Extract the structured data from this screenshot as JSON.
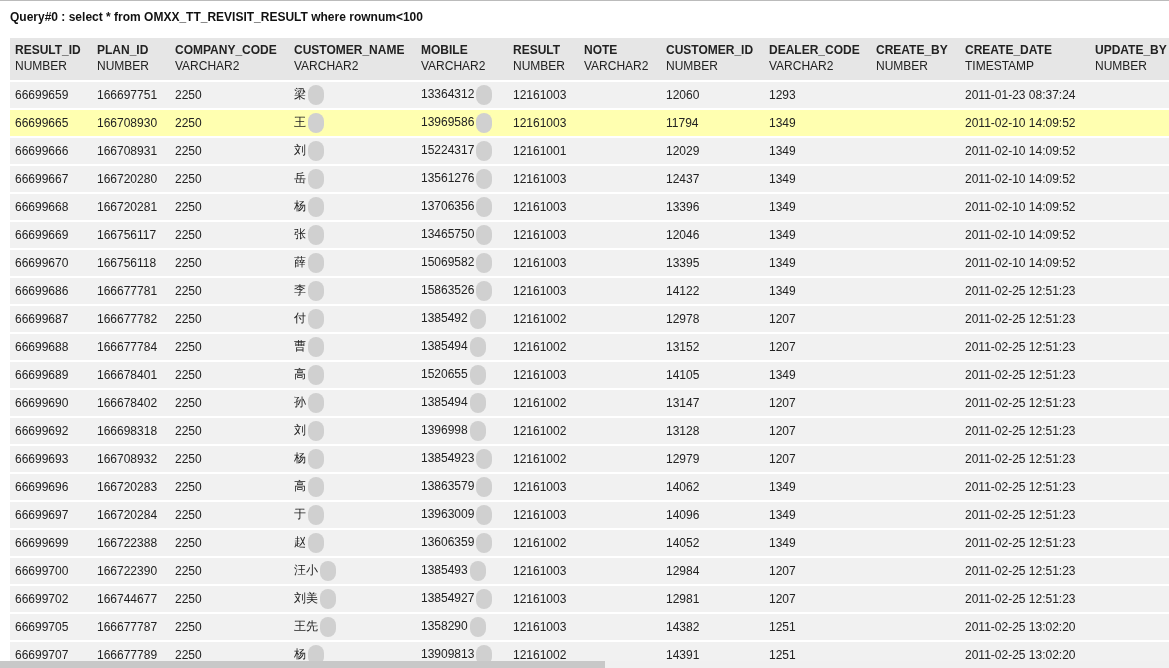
{
  "query_title": "Query#0 : select * from OMXX_TT_REVISIT_RESULT where rownum<100",
  "table": {
    "columns": [
      {
        "name": "RESULT_ID",
        "type": "NUMBER"
      },
      {
        "name": "PLAN_ID",
        "type": "NUMBER"
      },
      {
        "name": "COMPANY_CODE",
        "type": "VARCHAR2"
      },
      {
        "name": "CUSTOMER_NAME",
        "type": "VARCHAR2"
      },
      {
        "name": "MOBILE",
        "type": "VARCHAR2"
      },
      {
        "name": "RESULT",
        "type": "NUMBER"
      },
      {
        "name": "NOTE",
        "type": "VARCHAR2"
      },
      {
        "name": "CUSTOMER_ID",
        "type": "NUMBER"
      },
      {
        "name": "DEALER_CODE",
        "type": "VARCHAR2"
      },
      {
        "name": "CREATE_BY",
        "type": "NUMBER"
      },
      {
        "name": "CREATE_DATE",
        "type": "TIMESTAMP"
      },
      {
        "name": "UPDATE_BY",
        "type": "NUMBER"
      }
    ],
    "rows": [
      {
        "selected": false,
        "result_id": "66699659",
        "plan_id": "166697751",
        "company_code": "2250",
        "customer_name": "梁",
        "mobile": "13364312",
        "result": "12161003",
        "customer_id": "12060",
        "dealer_code": "1293",
        "create_date": "2011-01-23 08:37:24"
      },
      {
        "selected": true,
        "result_id": "66699665",
        "plan_id": "166708930",
        "company_code": "2250",
        "customer_name": "王",
        "mobile": "13969586",
        "result": "12161003",
        "customer_id": "11794",
        "dealer_code": "1349",
        "create_date": "2011-02-10 14:09:52"
      },
      {
        "selected": false,
        "result_id": "66699666",
        "plan_id": "166708931",
        "company_code": "2250",
        "customer_name": "刘",
        "mobile": "15224317",
        "result": "12161001",
        "customer_id": "12029",
        "dealer_code": "1349",
        "create_date": "2011-02-10 14:09:52"
      },
      {
        "selected": false,
        "result_id": "66699667",
        "plan_id": "166720280",
        "company_code": "2250",
        "customer_name": "岳",
        "mobile": "13561276",
        "result": "12161003",
        "customer_id": "12437",
        "dealer_code": "1349",
        "create_date": "2011-02-10 14:09:52"
      },
      {
        "selected": false,
        "result_id": "66699668",
        "plan_id": "166720281",
        "company_code": "2250",
        "customer_name": "杨",
        "mobile": "13706356",
        "result": "12161003",
        "customer_id": "13396",
        "dealer_code": "1349",
        "create_date": "2011-02-10 14:09:52"
      },
      {
        "selected": false,
        "result_id": "66699669",
        "plan_id": "166756117",
        "company_code": "2250",
        "customer_name": "张",
        "mobile": "13465750",
        "result": "12161003",
        "customer_id": "12046",
        "dealer_code": "1349",
        "create_date": "2011-02-10 14:09:52"
      },
      {
        "selected": false,
        "result_id": "66699670",
        "plan_id": "166756118",
        "company_code": "2250",
        "customer_name": "薛",
        "mobile": "15069582",
        "result": "12161003",
        "customer_id": "13395",
        "dealer_code": "1349",
        "create_date": "2011-02-10 14:09:52"
      },
      {
        "selected": false,
        "result_id": "66699686",
        "plan_id": "166677781",
        "company_code": "2250",
        "customer_name": "李",
        "mobile": "15863526",
        "result": "12161003",
        "customer_id": "14122",
        "dealer_code": "1349",
        "create_date": "2011-02-25 12:51:23"
      },
      {
        "selected": false,
        "result_id": "66699687",
        "plan_id": "166677782",
        "company_code": "2250",
        "customer_name": "付",
        "mobile": "1385492",
        "result": "12161002",
        "customer_id": "12978",
        "dealer_code": "1207",
        "create_date": "2011-02-25 12:51:23"
      },
      {
        "selected": false,
        "result_id": "66699688",
        "plan_id": "166677784",
        "company_code": "2250",
        "customer_name": "曹",
        "mobile": "1385494",
        "result": "12161002",
        "customer_id": "13152",
        "dealer_code": "1207",
        "create_date": "2011-02-25 12:51:23"
      },
      {
        "selected": false,
        "result_id": "66699689",
        "plan_id": "166678401",
        "company_code": "2250",
        "customer_name": "高",
        "mobile": "1520655",
        "result": "12161003",
        "customer_id": "14105",
        "dealer_code": "1349",
        "create_date": "2011-02-25 12:51:23"
      },
      {
        "selected": false,
        "result_id": "66699690",
        "plan_id": "166678402",
        "company_code": "2250",
        "customer_name": "孙",
        "mobile": "1385494",
        "result": "12161002",
        "customer_id": "13147",
        "dealer_code": "1207",
        "create_date": "2011-02-25 12:51:23"
      },
      {
        "selected": false,
        "result_id": "66699692",
        "plan_id": "166698318",
        "company_code": "2250",
        "customer_name": "刘",
        "mobile": "1396998",
        "result": "12161002",
        "customer_id": "13128",
        "dealer_code": "1207",
        "create_date": "2011-02-25 12:51:23"
      },
      {
        "selected": false,
        "result_id": "66699693",
        "plan_id": "166708932",
        "company_code": "2250",
        "customer_name": "杨",
        "mobile": "13854923",
        "result": "12161002",
        "customer_id": "12979",
        "dealer_code": "1207",
        "create_date": "2011-02-25 12:51:23"
      },
      {
        "selected": false,
        "result_id": "66699696",
        "plan_id": "166720283",
        "company_code": "2250",
        "customer_name": "高",
        "mobile": "13863579",
        "result": "12161003",
        "customer_id": "14062",
        "dealer_code": "1349",
        "create_date": "2011-02-25 12:51:23"
      },
      {
        "selected": false,
        "result_id": "66699697",
        "plan_id": "166720284",
        "company_code": "2250",
        "customer_name": "于",
        "mobile": "13963009",
        "result": "12161003",
        "customer_id": "14096",
        "dealer_code": "1349",
        "create_date": "2011-02-25 12:51:23"
      },
      {
        "selected": false,
        "result_id": "66699699",
        "plan_id": "166722388",
        "company_code": "2250",
        "customer_name": "赵",
        "mobile": "13606359",
        "result": "12161002",
        "customer_id": "14052",
        "dealer_code": "1349",
        "create_date": "2011-02-25 12:51:23"
      },
      {
        "selected": false,
        "result_id": "66699700",
        "plan_id": "166722390",
        "company_code": "2250",
        "customer_name": "汪小",
        "mobile": "1385493",
        "result": "12161003",
        "customer_id": "12984",
        "dealer_code": "1207",
        "create_date": "2011-02-25 12:51:23"
      },
      {
        "selected": false,
        "result_id": "66699702",
        "plan_id": "166744677",
        "company_code": "2250",
        "customer_name": "刘美",
        "mobile": "13854927",
        "result": "12161003",
        "customer_id": "12981",
        "dealer_code": "1207",
        "create_date": "2011-02-25 12:51:23"
      },
      {
        "selected": false,
        "result_id": "66699705",
        "plan_id": "166677787",
        "company_code": "2250",
        "customer_name": "王先",
        "mobile": "1358290",
        "result": "12161003",
        "customer_id": "14382",
        "dealer_code": "1251",
        "create_date": "2011-02-25 13:02:20"
      },
      {
        "selected": false,
        "result_id": "66699707",
        "plan_id": "166677789",
        "company_code": "2250",
        "customer_name": "杨",
        "mobile": "13909813",
        "result": "12161002",
        "customer_id": "14391",
        "dealer_code": "1251",
        "create_date": "2011-02-25 13:02:20"
      }
    ]
  }
}
